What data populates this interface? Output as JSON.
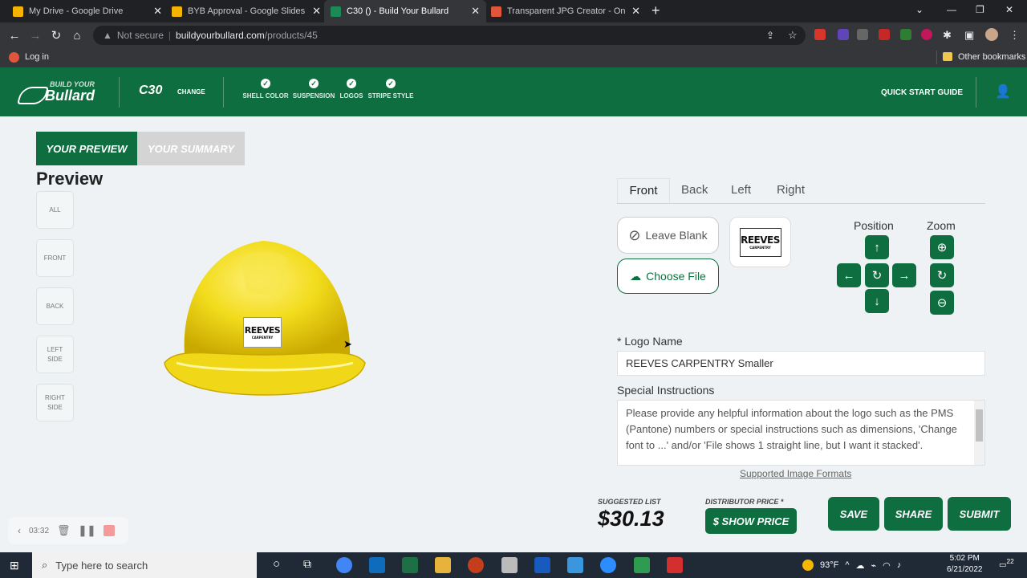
{
  "browser": {
    "tabs": [
      {
        "title": "My Drive - Google Drive",
        "icon": "google-drive-icon",
        "color": "#f4b400"
      },
      {
        "title": "BYB Approval - Google Slides",
        "icon": "google-slides-icon",
        "color": "#f4b400"
      },
      {
        "title": "C30 () - Build Your Bullard",
        "icon": "bullard-icon",
        "color": "#1b8a56"
      },
      {
        "title": "Transparent JPG Creator - Online",
        "icon": "tool-icon",
        "color": "#e0553b"
      }
    ],
    "url_security": "Not secure",
    "url_host": "buildyourbullard.com",
    "url_path": "/products/45",
    "bookmarks": {
      "login": "Log in",
      "other": "Other bookmarks"
    }
  },
  "header": {
    "logo_top": "BUILD YOUR",
    "logo_bottom": "Bullard",
    "model": "C30",
    "change": "CHANGE",
    "steps": [
      "SHELL COLOR",
      "SUSPENSION",
      "LOGOS",
      "STRIPE STYLE"
    ],
    "quick_start": "QUICK START GUIDE"
  },
  "left": {
    "tab_preview": "YOUR PREVIEW",
    "tab_summary": "YOUR SUMMARY",
    "title": "Preview",
    "views": [
      "ALL",
      "FRONT",
      "BACK",
      "LEFT SIDE",
      "RIGHT SIDE"
    ],
    "helmet_color": "#f2dc1c"
  },
  "logo_art": {
    "text": "REEVES",
    "subtext": "CARPENTRY"
  },
  "editor": {
    "placement_tabs": [
      "Front",
      "Back",
      "Left",
      "Right"
    ],
    "leave_blank": "Leave Blank",
    "choose_file": "Choose File",
    "position_label": "Position",
    "zoom_label": "Zoom",
    "logo_name_label": "* Logo Name",
    "logo_name_value": "REEVES CARPENTRY Smaller",
    "instructions_label": "Special Instructions",
    "instructions_placeholder": "Please provide any helpful information about the logo such as the PMS (Pantone) numbers or special instructions such as dimensions, 'Change font to ...' and/or 'File shows 1 straight line, but I want it stacked'.",
    "formats_link": "Supported Image Formats"
  },
  "pricing": {
    "suggested_label": "SUGGESTED LIST",
    "suggested_value": "$30.13",
    "distributor_label": "DISTRIBUTOR PRICE *",
    "show_price": "$ SHOW PRICE"
  },
  "actions": {
    "save": "SAVE",
    "share": "SHARE",
    "submit": "SUBMIT"
  },
  "recorder": {
    "time": "03:32"
  },
  "taskbar": {
    "search_placeholder": "Type here to search",
    "temperature": "93°F",
    "time": "5:02 PM",
    "date": "6/21/2022",
    "notifications": "22"
  },
  "colors": {
    "brand_green": "#0e6e40"
  }
}
